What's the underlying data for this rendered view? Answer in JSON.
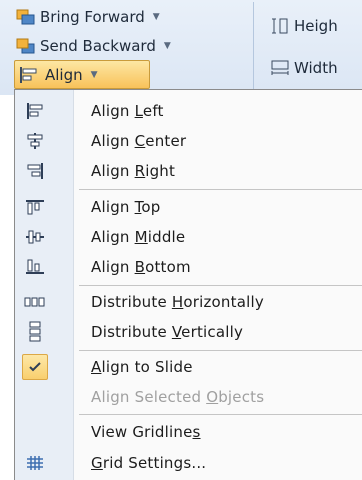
{
  "ribbon": {
    "bring_forward": "Bring Forward",
    "send_backward": "Send Backward",
    "align": "Align",
    "height": "Heigh",
    "width": "Width"
  },
  "menu": {
    "items": [
      {
        "pre": "Align ",
        "key": "L",
        "post": "eft",
        "icon": "align-left-icon"
      },
      {
        "pre": "Align ",
        "key": "C",
        "post": "enter",
        "icon": "align-center-icon"
      },
      {
        "pre": "Align ",
        "key": "R",
        "post": "ight",
        "icon": "align-right-icon"
      },
      {
        "pre": "Align ",
        "key": "T",
        "post": "op",
        "icon": "align-top-icon"
      },
      {
        "pre": "Align ",
        "key": "M",
        "post": "iddle",
        "icon": "align-middle-icon"
      },
      {
        "pre": "Align ",
        "key": "B",
        "post": "ottom",
        "icon": "align-bottom-icon"
      },
      {
        "pre": "Distribute ",
        "key": "H",
        "post": "orizontally",
        "icon": "distribute-horizontally-icon"
      },
      {
        "pre": "Distribute ",
        "key": "V",
        "post": "ertically",
        "icon": "distribute-vertically-icon"
      },
      {
        "pre": "",
        "key": "A",
        "post": "lign to Slide",
        "icon": "checkmark-icon"
      },
      {
        "pre": "Align Selected ",
        "key": "O",
        "post": "bjects",
        "icon": ""
      },
      {
        "pre": "View Gridline",
        "key": "s",
        "post": "",
        "icon": ""
      },
      {
        "pre": "",
        "key": "G",
        "post": "rid Settings...",
        "icon": "grid-icon"
      }
    ]
  },
  "colors": {
    "highlight": "#f8c25a",
    "gutter": "#e8eef6",
    "disabled_text": "#a0a0a0"
  }
}
